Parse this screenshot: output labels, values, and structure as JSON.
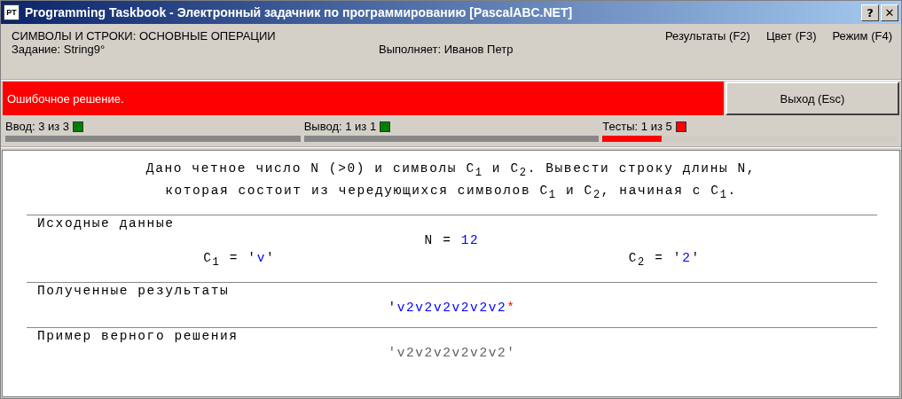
{
  "window": {
    "title": "Programming Taskbook - Электронный задачник по программированию [PascalABC.NET]",
    "app_icon": "PT",
    "buttons": [
      "?",
      "✕"
    ]
  },
  "header": {
    "group": "СИМВОЛЫ И СТРОКИ: ОСНОВНЫЕ ОПЕРАЦИИ",
    "task": "Задание: String9°",
    "student": "Выполняет: Иванов Петр",
    "menu": [
      "Результаты (F2)",
      "Цвет (F3)",
      "Режим (F4)"
    ]
  },
  "status": {
    "message": "Ошибочное решение.",
    "error": true,
    "exit_button": "Выход (Esc)"
  },
  "progress": [
    {
      "label": "Ввод: 3 из 3",
      "color": "#008000",
      "passed": true,
      "level": 1
    },
    {
      "label": "Вывод: 1 из 1",
      "color": "#008000",
      "passed": true,
      "level": 1
    },
    {
      "label": "Тесты: 1 из 5",
      "color": "#ff0000",
      "passed": false,
      "level": 0.2
    }
  ],
  "task_text": [
    "Дано четное число N (>0) и символы C$_{1}$ и C$_{2}$. Вывести строку длины N,",
    "которая состоит из чередующихся символов C$_{1}$ и C$_{2}$, начиная с C$_{1}$."
  ],
  "sections": [
    {
      "title": "Исходные данные",
      "lines": [
        [
          [
            {
              "kind": "plain",
              "text": "N = "
            },
            {
              "kind": "value",
              "text": "12"
            }
          ]
        ],
        [
          [
            {
              "kind": "plain",
              "text": "C$_{1}$ = '"
            },
            {
              "kind": "value",
              "text": "v"
            },
            {
              "kind": "plain",
              "text": "'"
            }
          ],
          [
            {
              "kind": "plain",
              "text": "C$_{2}$ = '"
            },
            {
              "kind": "value",
              "text": "2"
            },
            {
              "kind": "plain",
              "text": "'"
            }
          ]
        ]
      ]
    },
    {
      "title": "Полученные результаты",
      "lines": [
        [
          [
            {
              "kind": "plain",
              "text": "'"
            },
            {
              "kind": "value",
              "text": "v2v2v2v2v2v2"
            },
            {
              "kind": "error",
              "text": "*"
            }
          ]
        ]
      ]
    },
    {
      "title": "Пример верного решения",
      "lines": [
        [
          [
            {
              "kind": "sample",
              "text": "'v2v2v2v2v2v2'"
            }
          ]
        ]
      ]
    }
  ]
}
